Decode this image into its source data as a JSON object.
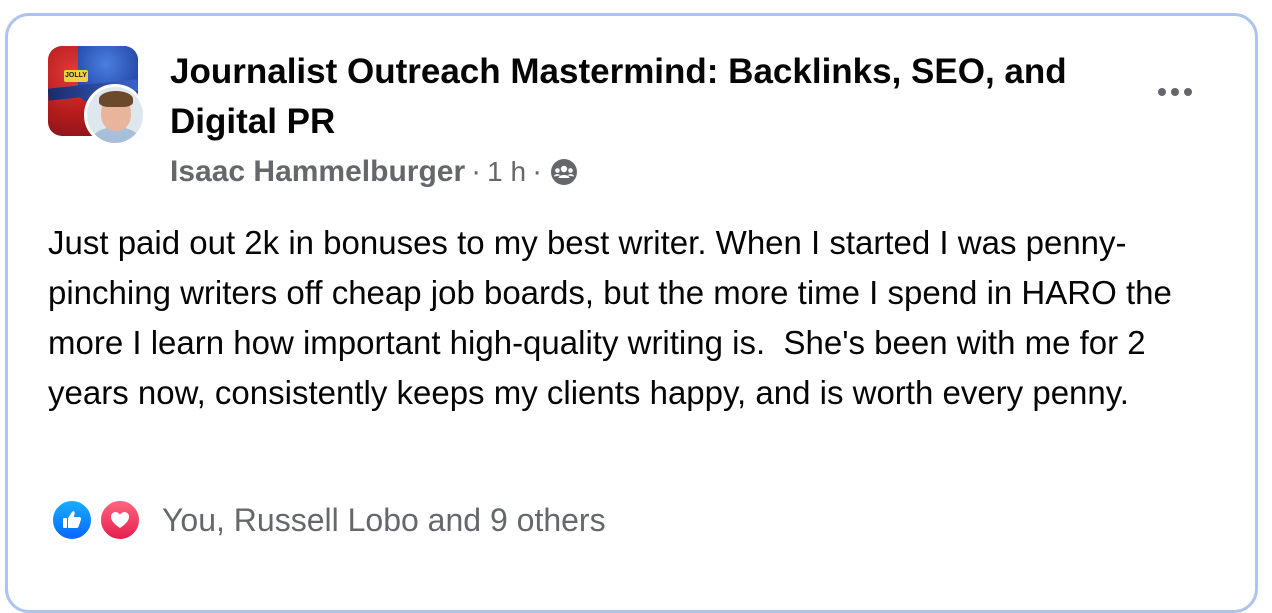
{
  "post": {
    "group_name": "Journalist Outreach Mastermind: Backlinks, SEO, and Digital PR",
    "author": "Isaac Hammelburger",
    "time": "1 h",
    "separator": "·",
    "audience_icon": "group-audience-icon",
    "more_icon": "more-options-icon",
    "body": "Just paid out 2k in bonuses to my best writer. When I started I was penny-pinching writers off cheap job boards, but the more time I spend in HARO the more I learn how important high-quality writing is.  She's been with me for 2 years now, consistently keeps my clients happy, and is worth every penny.",
    "group_logo_text": "JOLLY",
    "reactions": {
      "icons": [
        "like-icon",
        "love-icon"
      ],
      "summary": "You, Russell Lobo and 9 others"
    }
  },
  "colors": {
    "frame_border": "#aec4ef",
    "text_primary": "#050505",
    "text_secondary": "#65676b",
    "like": "#0866ff",
    "love": "#e61e4d"
  }
}
